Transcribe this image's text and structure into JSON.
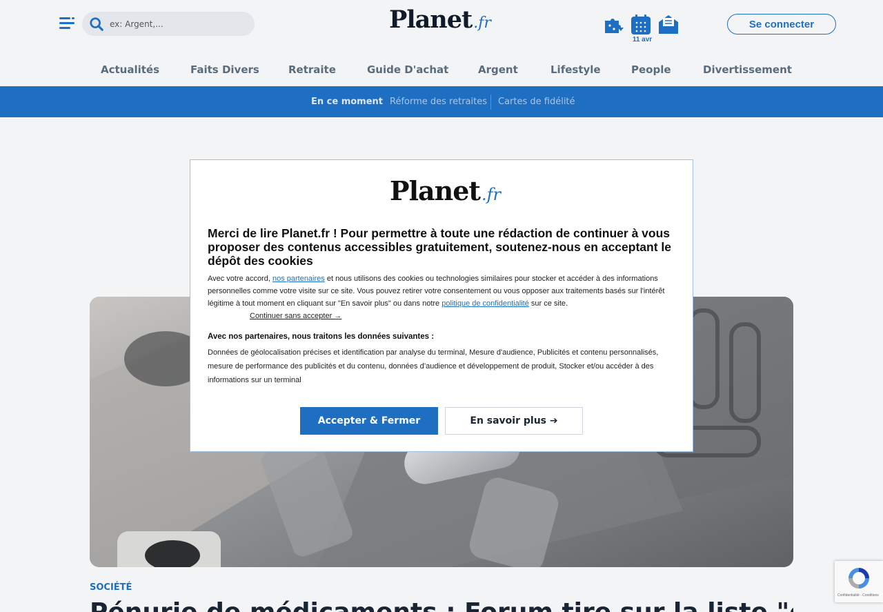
{
  "header": {
    "search_placeholder": "ex: Argent,...",
    "logo_main": "Planet",
    "logo_suffix": ".fr",
    "date_label": "11 avr",
    "login_label": "Se connecter"
  },
  "main_nav": [
    "Actualités",
    "Faits Divers",
    "Retraite",
    "Guide D'achat",
    "Argent",
    "Lifestyle",
    "People",
    "Divertissement"
  ],
  "sub_nav": {
    "current": "En ce moment",
    "items": [
      "Réforme des retraites",
      "Cartes de fidélité"
    ]
  },
  "article": {
    "category": "SOCIÉTÉ",
    "headline": "Pénurie de médicaments : Forum tire sur la liste \"critique\" de..."
  },
  "consent": {
    "logo_main": "Planet",
    "logo_suffix": ".fr",
    "title": "Merci de lire Planet.fr ! Pour permettre à toute une rédaction de continuer à vous proposer des contenus accessibles gratuitement, soutenez-nous en acceptant le dépôt des cookies",
    "body_part1": "Avec votre accord, ",
    "partners_link": "nos partenaires",
    "body_part2": " et nous utilisons des cookies ou technologies similaires pour stocker et accéder à des informations personnelles comme votre visite sur ce site. Vous pouvez retirer votre consentement ou vous opposer aux traitements basés sur l'intérêt légitime à tout moment en cliquant sur \"En savoir plus\" ou dans notre ",
    "privacy_link": "politique de confidentialité",
    "body_part3": " sur ce site.",
    "continue_label": "Continuer sans accepter →",
    "purposes_heading": "Avec nos partenaires, nous traitons les données suivantes :",
    "purposes_text": "Données de géolocalisation précises et identification par analyse du terminal, Mesure d'audience, Publicités et contenu personnalisés, mesure de performance des publicités et du contenu, données d’audience et développement de produit, Stocker et/ou accéder à des informations sur un terminal",
    "accept_label": "Accepter & Fermer",
    "more_label": "En savoir plus ➔"
  },
  "recaptcha": {
    "text": "Confidentialité - Conditions"
  },
  "colors": {
    "accent": "#1e6fc2",
    "background": "#f2f4f6",
    "text": "#1a2533"
  }
}
